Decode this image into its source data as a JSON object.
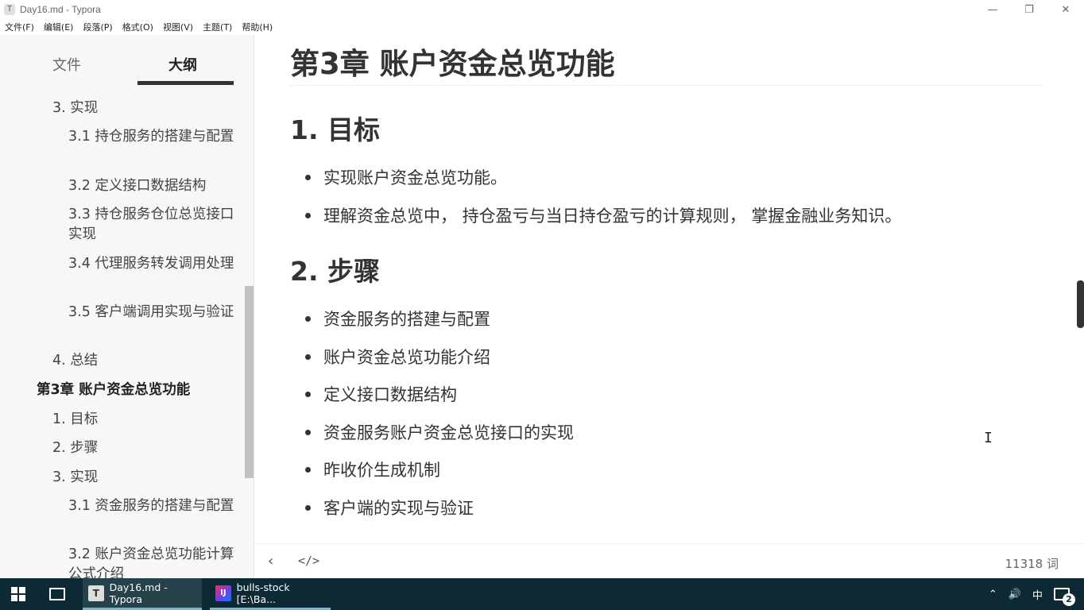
{
  "window": {
    "app_icon": "T",
    "title": "Day16.md - Typora",
    "minimize_icon": "—",
    "restore_icon": "❐",
    "close_icon": "✕"
  },
  "menu": [
    "文件(F)",
    "编辑(E)",
    "段落(P)",
    "格式(O)",
    "视图(V)",
    "主题(T)",
    "帮助(H)"
  ],
  "sidebar": {
    "tab_files": "文件",
    "tab_outline": "大纲",
    "outline": [
      {
        "label": "3. 实现"
      },
      {
        "label": "3.1 持仓服务的搭建与配置"
      },
      {
        "label": "3.2 定义接口数据结构"
      },
      {
        "label": "3.3 持仓服务仓位总览接口实现"
      },
      {
        "label": "3.4 代理服务转发调用处理"
      },
      {
        "label": "3.5 客户端调用实现与验证"
      },
      {
        "label": "4. 总结"
      },
      {
        "label": "第3章 账户资金总览功能"
      },
      {
        "label": "1. 目标"
      },
      {
        "label": "2. 步骤"
      },
      {
        "label": "3. 实现"
      },
      {
        "label": "3.1 资金服务的搭建与配置"
      },
      {
        "label": "3.2 账户资金总览功能计算公式介绍"
      }
    ]
  },
  "document": {
    "h1": "第3章 账户资金总览功能",
    "section1_title": "1. 目标",
    "section1_bullets": [
      "实现账户资金总览功能。",
      "理解资金总览中， 持仓盈亏与当日持仓盈亏的计算规则， 掌握金融业务知识。"
    ],
    "section2_title": "2. 步骤",
    "section2_bullets": [
      "资金服务的搭建与配置",
      "账户资金总览功能介绍",
      "定义接口数据结构",
      "资金服务账户资金总览接口的实现",
      "昨收价生成机制",
      "客户端的实现与验证"
    ]
  },
  "footer": {
    "back_icon": "‹",
    "source_icon": "</>",
    "word_count": "11318 词"
  },
  "taskbar": {
    "apps": [
      {
        "icon": "T",
        "label": "Day16.md - Typora"
      },
      {
        "icon": "IJ",
        "label": "bulls-stock [E:\\Ba..."
      }
    ],
    "tray_up_icon": "⌃",
    "volume_icon": "🔊",
    "ime": "中",
    "notification_count": "2"
  }
}
